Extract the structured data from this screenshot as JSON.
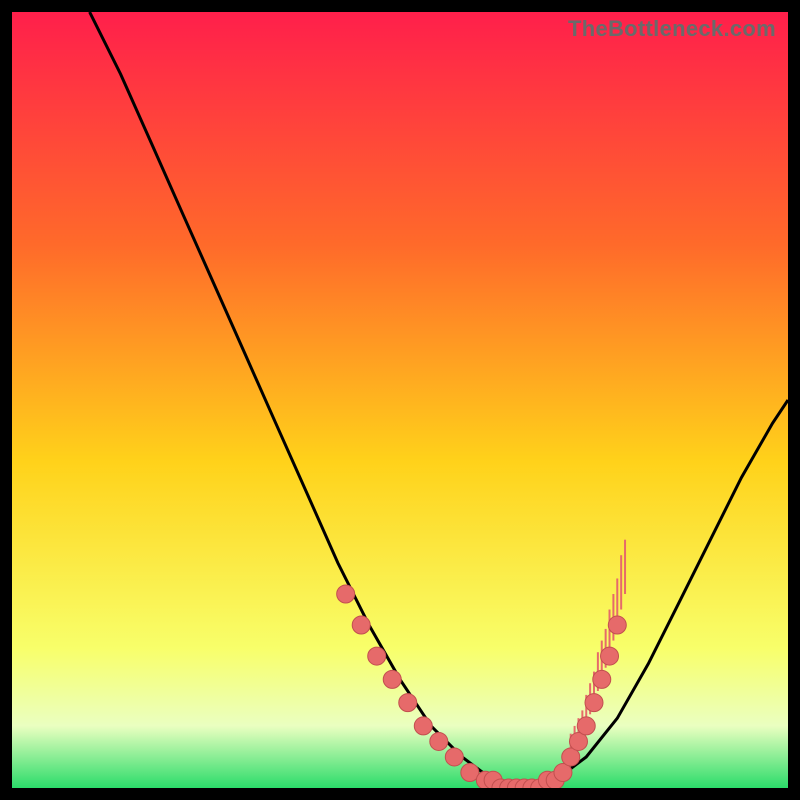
{
  "watermark": "TheBottleneck.com",
  "colors": {
    "gradient_top": "#ff1f4b",
    "gradient_mid1": "#ff6a2a",
    "gradient_mid2": "#ffd21a",
    "gradient_low": "#f8ff6a",
    "gradient_pale": "#eaffc0",
    "gradient_bottom": "#2bdc6a",
    "curve": "#000000",
    "marker_fill": "#e66a6a",
    "marker_stroke": "#c24f4f",
    "tick": "#e66a6a"
  },
  "chart_data": {
    "type": "line",
    "title": "",
    "xlabel": "",
    "ylabel": "",
    "xlim": [
      0,
      100
    ],
    "ylim": [
      0,
      100
    ],
    "series": [
      {
        "name": "bottleneck-curve",
        "x": [
          10,
          14,
          18,
          22,
          26,
          30,
          34,
          38,
          42,
          46,
          50,
          54,
          58,
          62,
          66,
          70,
          74,
          78,
          82,
          86,
          90,
          94,
          98,
          100
        ],
        "y": [
          100,
          92,
          83,
          74,
          65,
          56,
          47,
          38,
          29,
          21,
          14,
          8,
          4,
          1,
          0,
          1,
          4,
          9,
          16,
          24,
          32,
          40,
          47,
          50
        ]
      }
    ],
    "markers_left": {
      "name": "left-cluster",
      "x": [
        43,
        45,
        47,
        49,
        51,
        53,
        55,
        57,
        59
      ],
      "y": [
        25,
        21,
        17,
        14,
        11,
        8,
        6,
        4,
        2
      ]
    },
    "markers_bottom": {
      "name": "bottom-cluster",
      "x": [
        61,
        62,
        63,
        64,
        65,
        66,
        67,
        68,
        69,
        70,
        71
      ],
      "y": [
        1,
        1,
        0,
        0,
        0,
        0,
        0,
        0,
        1,
        1,
        2
      ]
    },
    "markers_right": {
      "name": "right-cluster",
      "x": [
        72,
        73,
        74,
        75,
        76,
        77,
        78
      ],
      "y": [
        4,
        6,
        8,
        11,
        14,
        17,
        21
      ]
    },
    "right_ticks": {
      "name": "right-tick-fringe",
      "x": [
        72,
        72.5,
        73,
        73.5,
        74,
        74.5,
        75,
        75.5,
        76,
        76.5,
        77,
        77.5,
        78,
        78.5,
        79
      ],
      "y": [
        4,
        5,
        6,
        7,
        8,
        9.5,
        11,
        12.5,
        14,
        15.5,
        17,
        19,
        21,
        23,
        25
      ],
      "len": [
        3,
        3,
        3,
        3,
        4,
        4,
        4,
        5,
        5,
        5,
        6,
        6,
        6,
        7,
        7
      ]
    }
  }
}
